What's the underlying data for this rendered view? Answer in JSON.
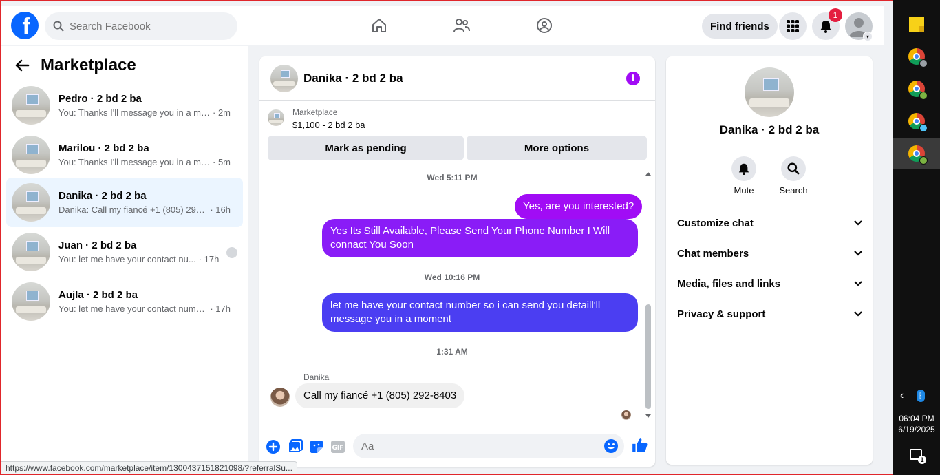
{
  "topnav": {
    "logo_letter": "f",
    "search_placeholder": "Search Facebook",
    "find_friends_label": "Find friends",
    "notification_count": "1"
  },
  "left_panel": {
    "title": "Marketplace",
    "conversations": [
      {
        "name": "Pedro · 2 bd 2 ba",
        "preview": "You: Thanks I'll message you in a mo...",
        "time": "· 2m",
        "active": false
      },
      {
        "name": "Marilou · 2 bd 2 ba",
        "preview": "You: Thanks I'll message you in a mo...",
        "time": "· 5m",
        "active": false
      },
      {
        "name": "Danika · 2 bd 2 ba",
        "preview": "Danika: Call my fiancé +1 (805) 292-...",
        "time": "· 16h",
        "active": true
      },
      {
        "name": "Juan · 2 bd 2 ba",
        "preview": "You: let me have your contact nu...",
        "time": "· 17h",
        "active": false
      },
      {
        "name": "Aujla · 2 bd 2 ba",
        "preview": "You: let me have your contact numb...",
        "time": "· 17h",
        "active": false
      }
    ]
  },
  "chat": {
    "title": "Danika · 2 bd 2 ba",
    "info_glyph": "i",
    "marketplace_label": "Marketplace",
    "listing": "$1,100 - 2 bd 2 ba",
    "mark_pending_label": "Mark as pending",
    "more_options_label": "More options",
    "timestamps": [
      "Wed 5:11 PM",
      "Wed 10:16 PM",
      "1:31 AM"
    ],
    "messages": [
      {
        "from": "me",
        "text": "Yes, are you interested?"
      },
      {
        "from": "me",
        "text": "Yes Its Still Available, Please Send Your Phone Number I Will connact You Soon"
      },
      {
        "from": "me",
        "text": "let me have your contact number so i can send you detaill'll message you in a moment"
      },
      {
        "from": "Danika",
        "text": "Call my fiancé +1 (805) 292-8403"
      }
    ],
    "incoming_sender": "Danika",
    "composer_placeholder": "Aa"
  },
  "right_panel": {
    "title": "Danika · 2 bd 2 ba",
    "mute_label": "Mute",
    "search_label": "Search",
    "sections": [
      "Customize chat",
      "Chat members",
      "Media, files and links",
      "Privacy & support"
    ]
  },
  "status_url": "https://www.facebook.com/marketplace/item/1300437151821098/?referralSu...",
  "taskbar": {
    "time": "06:04 PM",
    "date": "6/19/2025",
    "notif_count": "1"
  },
  "colors": {
    "facebook_blue": "#0866ff",
    "bubble_purple": "#a10cf5",
    "bubble_indigo": "#4b3ef2",
    "badge_red": "#e41e3f"
  }
}
